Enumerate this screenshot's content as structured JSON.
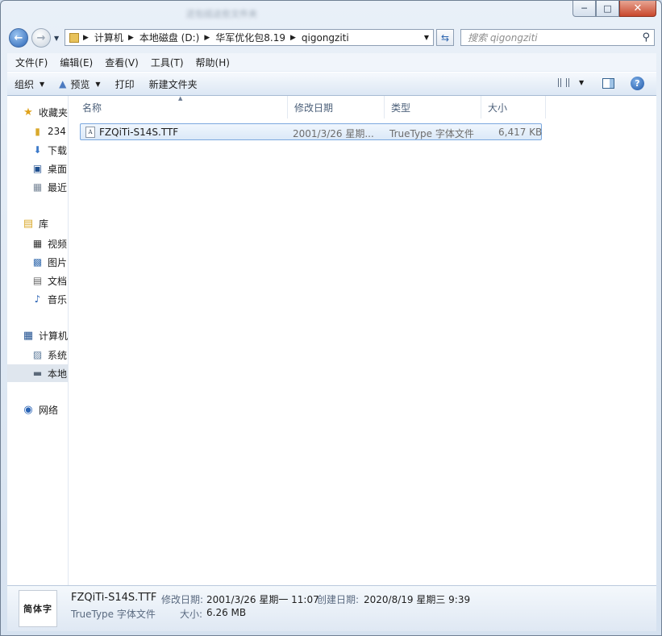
{
  "window": {
    "title": "还包括这些文件夹",
    "minimize": "─",
    "maximize": "□",
    "close": "✕"
  },
  "address": {
    "crumbs": [
      "计算机",
      "本地磁盘 (D:)",
      "华军优化包8.19",
      "qigongziti"
    ],
    "search_placeholder": "搜索 qigongziti"
  },
  "menubar": [
    "文件(F)",
    "编辑(E)",
    "查看(V)",
    "工具(T)",
    "帮助(H)"
  ],
  "commandbar": {
    "organize": "组织",
    "preview": "预览",
    "print": "打印",
    "new_folder": "新建文件夹"
  },
  "navpane": {
    "favorites": "收藏夹",
    "fav_items": [
      "234",
      "下载",
      "桌面",
      "最近"
    ],
    "libraries": "库",
    "lib_items": [
      "视频",
      "图片",
      "文档",
      "音乐"
    ],
    "computer": "计算机",
    "comp_items": [
      "系统",
      "本地"
    ],
    "network": "网络"
  },
  "columns": [
    "名称",
    "修改日期",
    "类型",
    "大小"
  ],
  "files": [
    {
      "name": "FZQiTi-S14S.TTF",
      "modified": "2001/3/26 星期...",
      "type": "TrueType 字体文件",
      "size": "6,417 KB"
    }
  ],
  "details": {
    "thumb_text": "简体字",
    "name": "FZQiTi-S14S.TTF",
    "type": "TrueType 字体文件",
    "modified_label": "修改日期:",
    "modified_value": "2001/3/26 星期一 11:07",
    "created_label": "创建日期:",
    "created_value": "2020/8/19 星期三 9:39",
    "size_label": "大小:",
    "size_value": "6.26 MB"
  },
  "colors": {
    "selection_border": "#7ba8de",
    "selection_fill": "#dbe9f8",
    "accent": "#2a64b5"
  }
}
